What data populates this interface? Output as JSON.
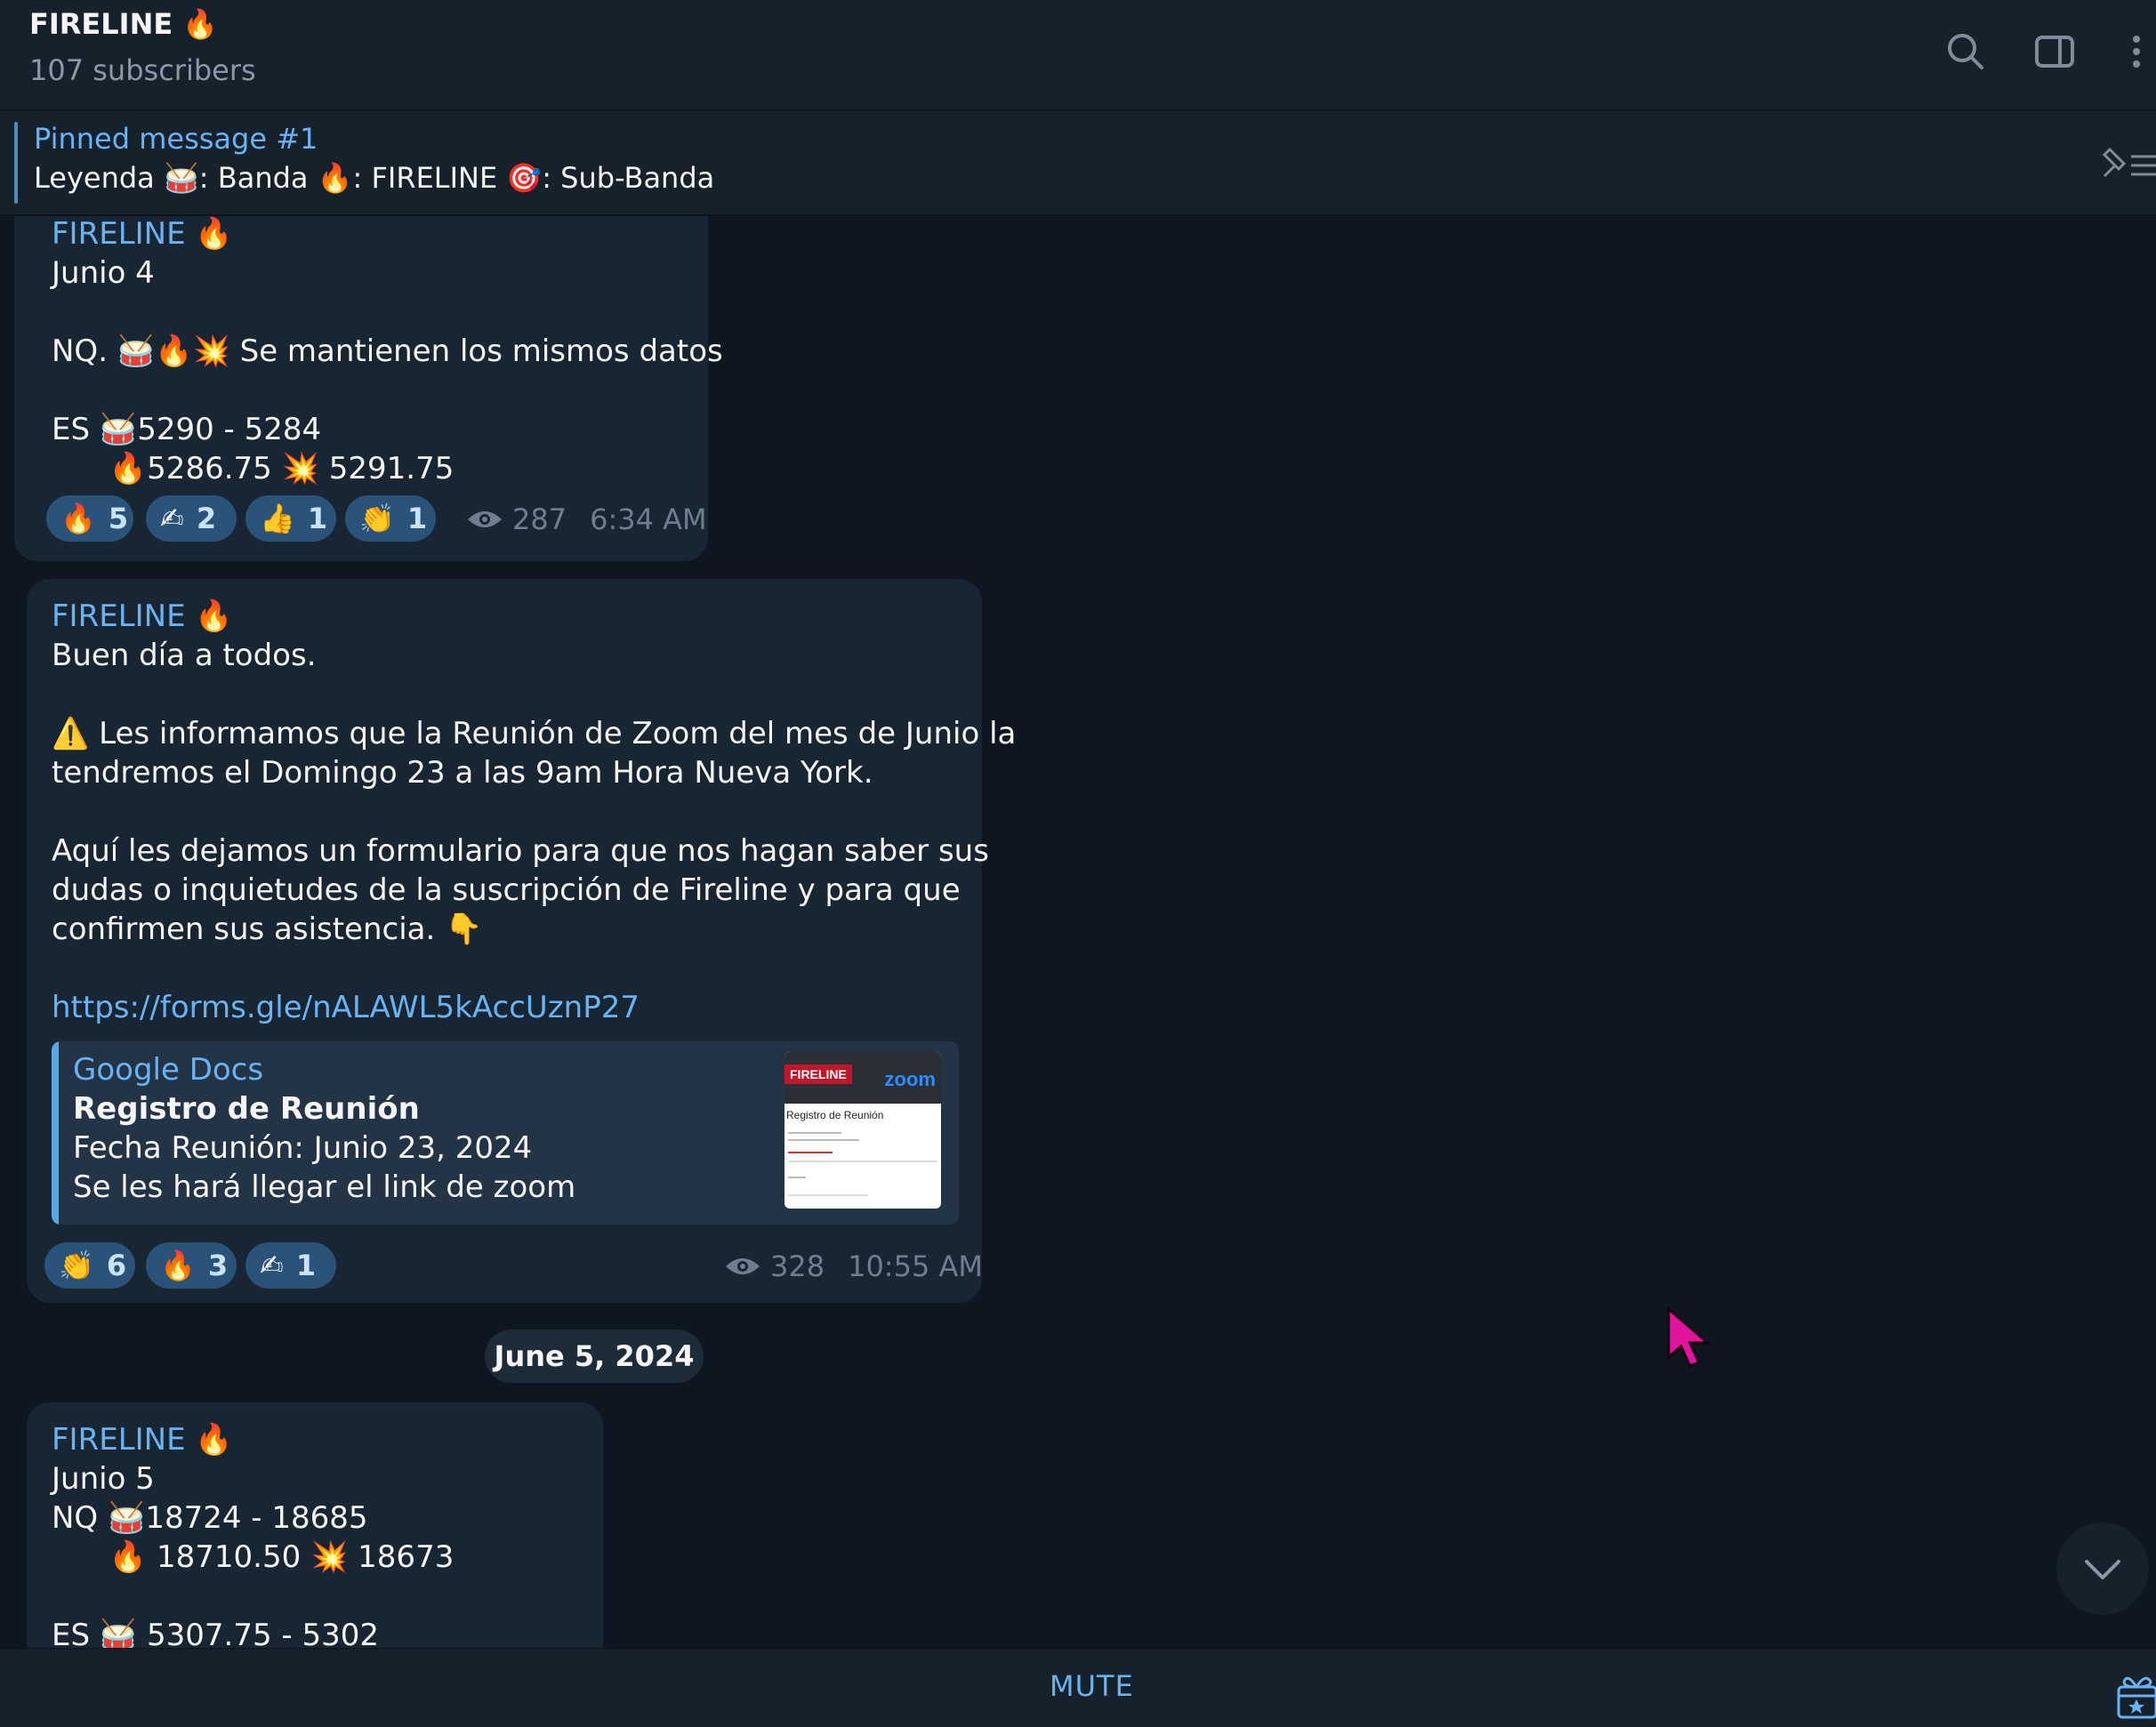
{
  "header": {
    "title": "FIRELINE 🔥",
    "subtitle": "107 subscribers",
    "icons": [
      "search-icon",
      "sidebar-toggle-icon",
      "more-icon"
    ]
  },
  "pinned": {
    "title": "Pinned message #1",
    "text": "Leyenda 🥁: Banda  🔥: FIRELINE  🎯: Sub-Banda"
  },
  "messages": [
    {
      "sender": "FIRELINE 🔥",
      "lines": [
        "Junio 4",
        "",
        "NQ.   🥁🔥💥 Se mantienen los mismos datos",
        "",
        "ES 🥁5290 - 5284",
        "      🔥5286.75 💥 5291.75"
      ],
      "reactions": [
        {
          "emoji": "🔥",
          "count": "5"
        },
        {
          "emoji": "✍",
          "count": "2"
        },
        {
          "emoji": "👍",
          "count": "1"
        },
        {
          "emoji": "👏",
          "count": "1"
        }
      ],
      "views": "287",
      "time": "6:34 AM"
    },
    {
      "sender": "FIRELINE 🔥",
      "lines": [
        "Buen día a todos.",
        "",
        "⚠️ Les informamos que la Reunión de Zoom del mes de Junio la",
        "tendremos el Domingo 23 a las 9am Hora Nueva York.",
        "",
        "Aquí les dejamos un formulario para que nos hagan saber sus",
        "dudas o inquietudes de la suscripción de Fireline y para que",
        "confirmen sus asistencia. 👇",
        ""
      ],
      "link": "https://forms.gle/nALAWL5kAccUznP27",
      "preview": {
        "site": "Google Docs",
        "title": "Registro de Reunión",
        "line1": "Fecha Reunión: Junio 23, 2024",
        "line2": "Se les hará llegar el link de zoom",
        "thumb_logo": "FIRELINE",
        "thumb_brand": "zoom",
        "thumb_title": "Registro de Reunión"
      },
      "reactions": [
        {
          "emoji": "👏",
          "count": "6"
        },
        {
          "emoji": "🔥",
          "count": "3"
        },
        {
          "emoji": "✍",
          "count": "1"
        }
      ],
      "views": "328",
      "time": "10:55 AM"
    },
    {
      "sender": "FIRELINE 🔥",
      "lines": [
        "Junio 5",
        "NQ 🥁18724 - 18685",
        "      🔥 18710.50 💥 18673",
        "",
        "ES 🥁 5307.75 - 5302"
      ]
    }
  ],
  "date_separator": "June 5, 2024",
  "bottom": {
    "mute_label": "MUTE"
  },
  "colors": {
    "background": "#0e1621",
    "bubble": "#182533",
    "accent": "#6ab3f3",
    "reaction": "#2b5278"
  }
}
